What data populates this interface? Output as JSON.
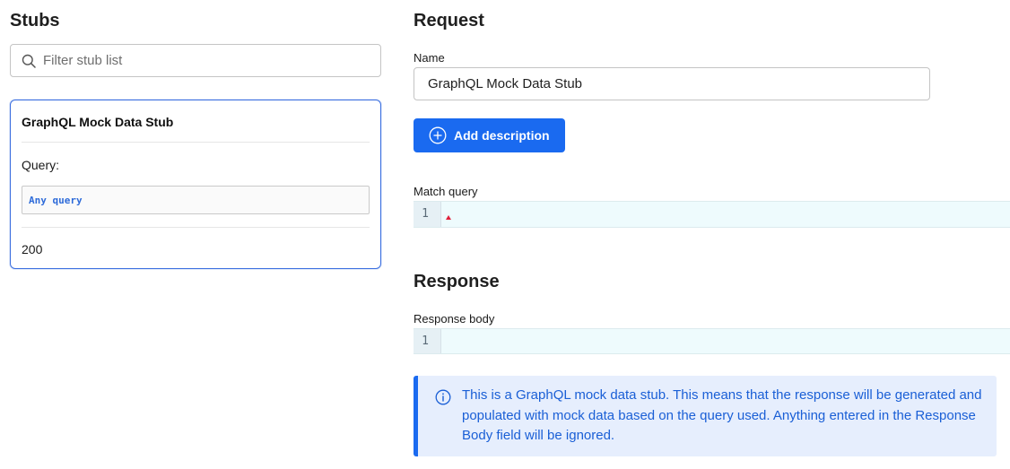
{
  "stubs_panel": {
    "title": "Stubs",
    "filter": {
      "placeholder": "Filter stub list",
      "value": "",
      "icon": "search-icon"
    },
    "cards": [
      {
        "title": "GraphQL Mock Data Stub",
        "query_label": "Query:",
        "query_value": "Any query",
        "status": "200",
        "selected": true
      }
    ]
  },
  "request": {
    "title": "Request",
    "name_label": "Name",
    "name_value": "GraphQL Mock Data Stub",
    "add_description_label": "Add description",
    "match_query_label": "Match query",
    "match_query_line": "1"
  },
  "response": {
    "title": "Response",
    "body_label": "Response body",
    "body_line": "1",
    "info_text": "This is a GraphQL mock data stub. This means that the response will be generated and populated with mock data based on the query used. Anything entered in the Response Body field will be ignored."
  },
  "colors": {
    "accent": "#1a6af0",
    "card_border": "#3b6fe0",
    "info_background": "#e6eefd",
    "info_text": "#1a5fd6",
    "editor_background": "#eefbfd",
    "error_caret": "#e0203a"
  }
}
